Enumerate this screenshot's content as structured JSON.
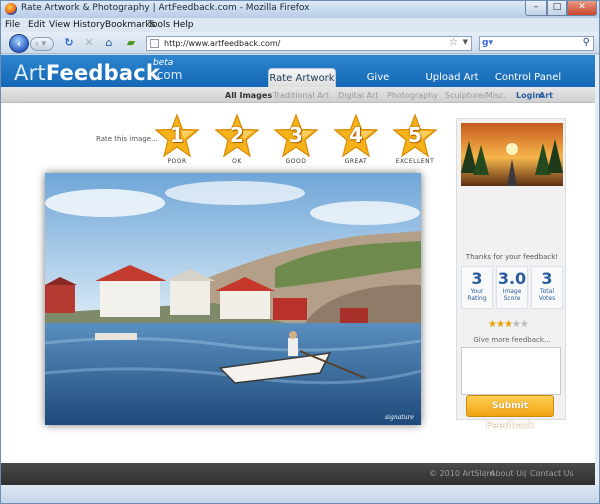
{
  "window": {
    "title": "Rate Artwork & Photography | ArtFeedback.com - Mozilla Firefox"
  },
  "menu": [
    "File",
    "Edit",
    "View",
    "History",
    "Bookmarks",
    "Tools",
    "Help"
  ],
  "navbar": {
    "url": "http://www.artfeedback.com/"
  },
  "site": {
    "logo_art": "Art",
    "logo_feedback": "Feedback",
    "logo_com": ".com",
    "logo_beta": "beta",
    "tabs": [
      {
        "label": "Rate Artwork",
        "active": true
      },
      {
        "label": "Give Feedback",
        "active": false
      },
      {
        "label": "Upload Art",
        "active": false
      },
      {
        "label": "Control Panel",
        "active": false
      }
    ],
    "subnav": [
      "All Images",
      "Traditional Art",
      "Digital Art",
      "Photography",
      "Sculpture/Misc."
    ],
    "login_label": "Login:",
    "login_link": "Art"
  },
  "rating": {
    "prompt": "Rate this image...",
    "stars": [
      {
        "num": "1",
        "caption": "POOR"
      },
      {
        "num": "2",
        "caption": "OK"
      },
      {
        "num": "3",
        "caption": "GOOD"
      },
      {
        "num": "4",
        "caption": "GREAT"
      },
      {
        "num": "5",
        "caption": "EXCELLENT"
      }
    ]
  },
  "sidebar": {
    "thanks": "Thanks for your feedback!",
    "scores": [
      {
        "value": "3",
        "label1": "Your",
        "label2": "Rating"
      },
      {
        "value": "3.0",
        "label1": "Image",
        "label2": "Score"
      },
      {
        "value": "3",
        "label1": "Total",
        "label2": "Votes"
      }
    ],
    "stars_filled": 3,
    "stars_total": 5,
    "give_more": "Give more feedback...",
    "submit_label": "Submit Feedback"
  },
  "footer": {
    "copyright": "© 2010 ArtSlam",
    "about": "About Us",
    "contact": "Contact Us"
  },
  "colors": {
    "header_blue": "#1a6fbe",
    "accent_orange": "#f0a312",
    "link_blue": "#2a5da0"
  }
}
